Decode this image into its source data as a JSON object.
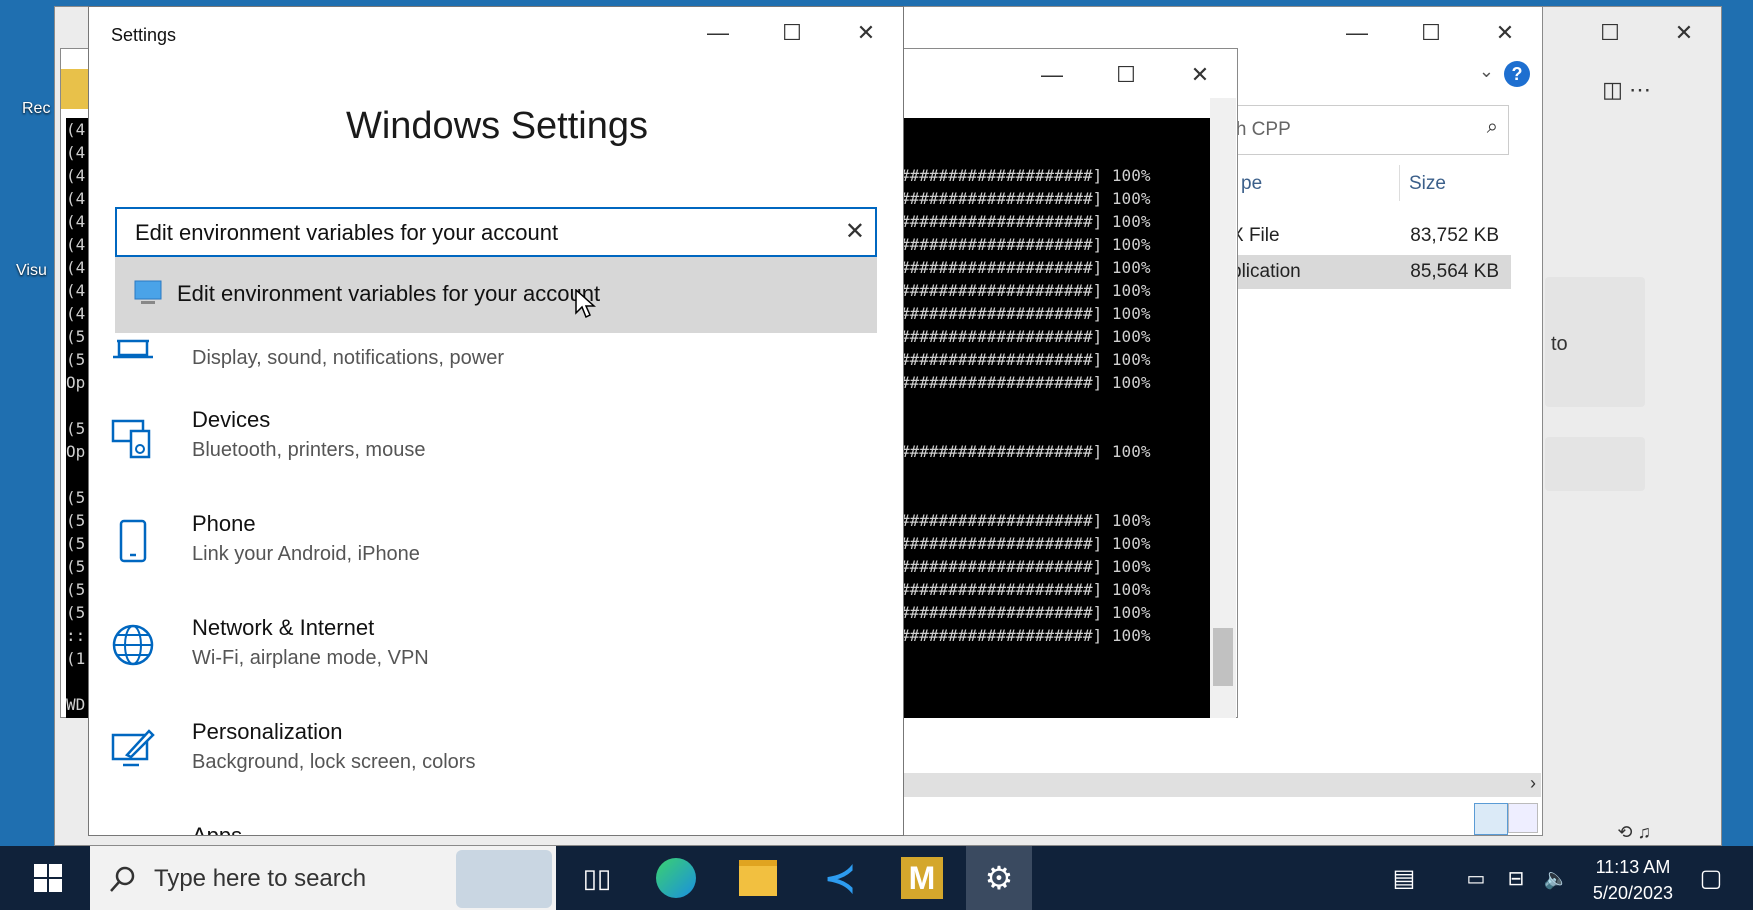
{
  "desktop": {
    "icons": [
      {
        "label": "Rec"
      },
      {
        "label": "Visu"
      }
    ]
  },
  "explorer": {
    "search_placeholder": "rch CPP",
    "col_type": "pe",
    "col_size": "Size",
    "rows": [
      {
        "type": "X File",
        "size": "83,752 KB"
      },
      {
        "type": "plication",
        "size": "85,564 KB"
      }
    ],
    "side_text": "to"
  },
  "terminal": {
    "lines": [
      "####################] 100%",
      "####################] 100%",
      "####################] 100%",
      "####################] 100%",
      "####################] 100%",
      "####################] 100%",
      "####################] 100%",
      "####################] 100%",
      "####################] 100%",
      "####################] 100%",
      "",
      "",
      "####################] 100%",
      "",
      "",
      "####################] 100%",
      "####################] 100%",
      "####################] 100%",
      "####################] 100%",
      "####################] 100%",
      "####################] 100%"
    ],
    "left_prefix": "(4\n(4\n(4\n(4\n(4\n(4\n(4\n(4\n(4\n(5\n(5\nOp\n\n(5\nOp\n\n(5\n(5\n(5\n(5\n(5\n(5\n::\n(1\n\nWD\n#"
  },
  "settings": {
    "window_title": "Settings",
    "heading": "Windows Settings",
    "search_value": "Edit environment variables for your account",
    "suggestion": "Edit environment variables for your account",
    "categories": [
      {
        "name": "",
        "desc": "Display, sound, notifications, power",
        "icon": "laptop-icon"
      },
      {
        "name": "Devices",
        "desc": "Bluetooth, printers, mouse",
        "icon": "devices-icon"
      },
      {
        "name": "Phone",
        "desc": "Link your Android, iPhone",
        "icon": "phone-icon"
      },
      {
        "name": "Network & Internet",
        "desc": "Wi-Fi, airplane mode, VPN",
        "icon": "globe-icon"
      },
      {
        "name": "Personalization",
        "desc": "Background, lock screen, colors",
        "icon": "personalization-icon"
      },
      {
        "name": "Apps",
        "desc": "",
        "icon": "apps-icon"
      }
    ]
  },
  "taskbar": {
    "search_placeholder": "Type here to search",
    "time": "11:13 AM",
    "date": "5/20/2023"
  },
  "colors": {
    "accent": "#0067c0",
    "taskbar": "#10223a",
    "suggest_bg": "#d7d7d7"
  }
}
